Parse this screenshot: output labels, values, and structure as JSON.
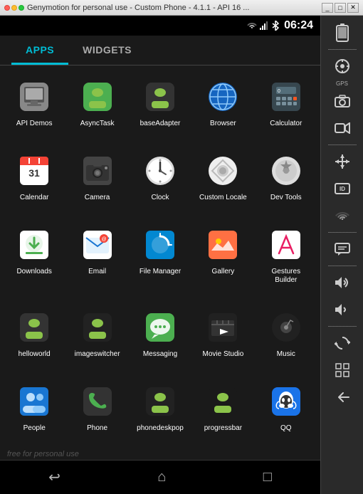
{
  "titleBar": {
    "title": "Genymotion for personal use - Custom Phone - 4.1.1 - API 16 ...",
    "controls": [
      "_",
      "□",
      "✕"
    ]
  },
  "statusBar": {
    "time": "06:24",
    "icons": [
      "wifi",
      "signal",
      "bluetooth",
      "battery"
    ]
  },
  "tabs": [
    {
      "id": "apps",
      "label": "APPS",
      "active": true
    },
    {
      "id": "widgets",
      "label": "WIDGETS",
      "active": false
    }
  ],
  "apps": [
    {
      "id": "api-demos",
      "label": "API Demos",
      "icon": "📁",
      "iconClass": "icon-api-demos"
    },
    {
      "id": "asynctask",
      "label": "AsyncTask",
      "icon": "🤖",
      "iconClass": "icon-android-green"
    },
    {
      "id": "baseadapter",
      "label": "baseAdapter",
      "icon": "🤖",
      "iconClass": "icon-android-dark"
    },
    {
      "id": "browser",
      "label": "Browser",
      "icon": "🌐",
      "iconClass": "icon-browser"
    },
    {
      "id": "calculator",
      "label": "Calculator",
      "icon": "🔢",
      "iconClass": "icon-calculator"
    },
    {
      "id": "calendar",
      "label": "Calendar",
      "icon": "📅",
      "iconClass": "icon-calendar"
    },
    {
      "id": "camera",
      "label": "Camera",
      "icon": "📷",
      "iconClass": "icon-camera"
    },
    {
      "id": "clock",
      "label": "Clock",
      "icon": "🕐",
      "iconClass": "icon-clock"
    },
    {
      "id": "custom-locale",
      "label": "Custom Locale",
      "icon": "⚙",
      "iconClass": "icon-settings-bg"
    },
    {
      "id": "dev-tools",
      "label": "Dev Tools",
      "icon": "⚙",
      "iconClass": "icon-devtools"
    },
    {
      "id": "downloads",
      "label": "Downloads",
      "icon": "⬇",
      "iconClass": "icon-downloads"
    },
    {
      "id": "email",
      "label": "Email",
      "icon": "✉",
      "iconClass": "icon-email"
    },
    {
      "id": "file-manager",
      "label": "File Manager",
      "icon": "🔄",
      "iconClass": "icon-filemanager"
    },
    {
      "id": "gallery",
      "label": "Gallery",
      "icon": "🖼",
      "iconClass": "icon-gallery"
    },
    {
      "id": "gestures-builder",
      "label": "Gestures Builder",
      "icon": "✂",
      "iconClass": "icon-gestures"
    },
    {
      "id": "helloworld",
      "label": "helloworld",
      "icon": "🤖",
      "iconClass": "icon-hello"
    },
    {
      "id": "imageswitcher",
      "label": "imageswitcher",
      "icon": "🤖",
      "iconClass": "icon-imageswitch"
    },
    {
      "id": "messaging",
      "label": "Messaging",
      "icon": "💬",
      "iconClass": "icon-messaging"
    },
    {
      "id": "movie-studio",
      "label": "Movie Studio",
      "icon": "🎬",
      "iconClass": "icon-movie"
    },
    {
      "id": "music",
      "label": "Music",
      "icon": "🎵",
      "iconClass": "icon-music"
    },
    {
      "id": "people",
      "label": "People",
      "icon": "👤",
      "iconClass": "icon-people"
    },
    {
      "id": "phone",
      "label": "Phone",
      "icon": "📞",
      "iconClass": "icon-phone"
    },
    {
      "id": "phonedeskpop",
      "label": "phonedeskpop",
      "icon": "🤖",
      "iconClass": "icon-phonedesk"
    },
    {
      "id": "progressbar",
      "label": "progressbar",
      "icon": "🤖",
      "iconClass": "icon-progressbar"
    },
    {
      "id": "qq",
      "label": "QQ",
      "icon": "🐧",
      "iconClass": "icon-qq"
    }
  ],
  "bottomNav": {
    "back": "↩",
    "home": "⌂",
    "recents": "□"
  },
  "sidebar": {
    "icons": [
      {
        "id": "battery",
        "symbol": "🔋",
        "label": ""
      },
      {
        "id": "gps",
        "symbol": "📡",
        "label": "GPS"
      },
      {
        "id": "camera2",
        "symbol": "⊙",
        "label": ""
      },
      {
        "id": "video",
        "symbol": "🎥",
        "label": ""
      },
      {
        "id": "move",
        "symbol": "✛",
        "label": ""
      },
      {
        "id": "id-card",
        "symbol": "🪪",
        "label": ""
      },
      {
        "id": "wifi2",
        "symbol": "≋",
        "label": ""
      },
      {
        "id": "sms",
        "symbol": "▬",
        "label": ""
      },
      {
        "id": "vol-up",
        "symbol": "🔊",
        "label": ""
      },
      {
        "id": "vol-down",
        "symbol": "🔉",
        "label": ""
      },
      {
        "id": "rotate",
        "symbol": "⟳",
        "label": ""
      },
      {
        "id": "dpi",
        "symbol": "⊞",
        "label": ""
      },
      {
        "id": "back2",
        "symbol": "↩",
        "label": ""
      }
    ]
  },
  "watermark": "free for personal use"
}
